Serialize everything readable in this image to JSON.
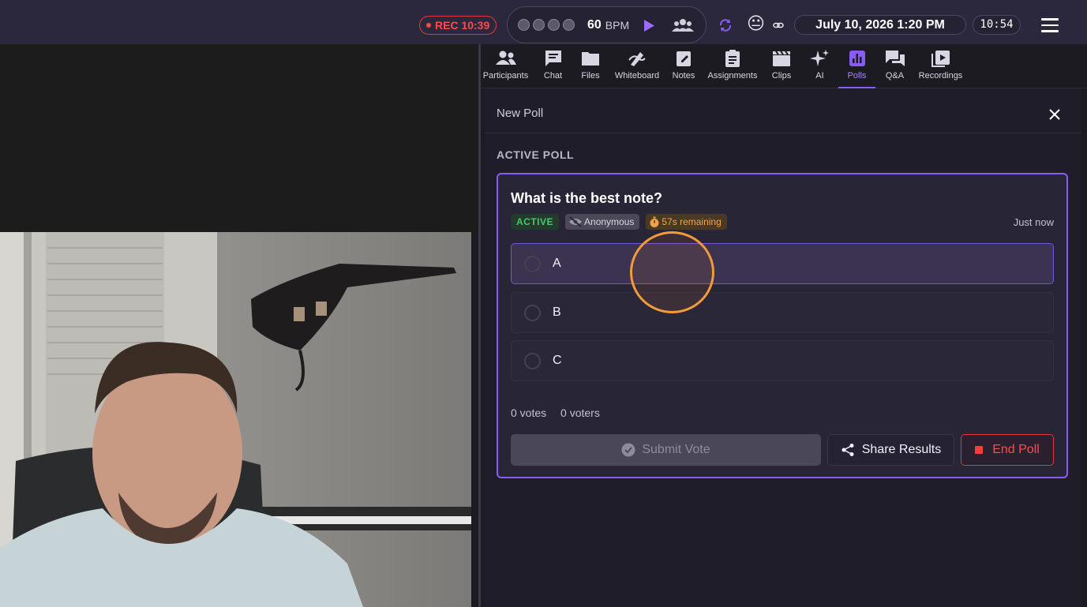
{
  "topbar": {
    "recording": "REC 10:39",
    "metronome": {
      "bpm": "60",
      "bpm_unit": "BPM",
      "beats": 4
    },
    "emoji": "😐",
    "datetime": "July 10, 2026 1:20 PM",
    "clock": "10:54"
  },
  "tabs": [
    {
      "label": "Participants",
      "icon": "participants-icon"
    },
    {
      "label": "Chat",
      "icon": "chat-icon"
    },
    {
      "label": "Files",
      "icon": "folder-icon"
    },
    {
      "label": "Whiteboard",
      "icon": "whiteboard-icon"
    },
    {
      "label": "Notes",
      "icon": "notes-icon"
    },
    {
      "label": "Assignments",
      "icon": "clipboard-icon"
    },
    {
      "label": "Clips",
      "icon": "clapperboard-icon"
    },
    {
      "label": "AI",
      "icon": "sparkle-icon"
    },
    {
      "label": "Polls",
      "icon": "poll-chart-icon",
      "active": true
    },
    {
      "label": "Q&A",
      "icon": "qa-icon"
    },
    {
      "label": "Recordings",
      "icon": "recordings-icon"
    }
  ],
  "poll_panel": {
    "header_title": "New Poll",
    "section_label": "ACTIVE POLL",
    "poll": {
      "question": "What is the best note?",
      "status_badge": "ACTIVE",
      "anonymous_badge": "Anonymous",
      "timer_badge": "57s remaining",
      "posted": "Just now",
      "options": [
        {
          "label": "A",
          "selected": true
        },
        {
          "label": "B",
          "selected": false
        },
        {
          "label": "C",
          "selected": false
        }
      ],
      "votes": "0 votes",
      "voters": "0 voters",
      "submit_label": "Submit Vote",
      "share_label": "Share Results",
      "end_label": "End Poll"
    }
  },
  "colors": {
    "accent": "#8a5cf6",
    "danger": "#e0393b",
    "success": "#44c870",
    "warning": "#f2a347"
  }
}
